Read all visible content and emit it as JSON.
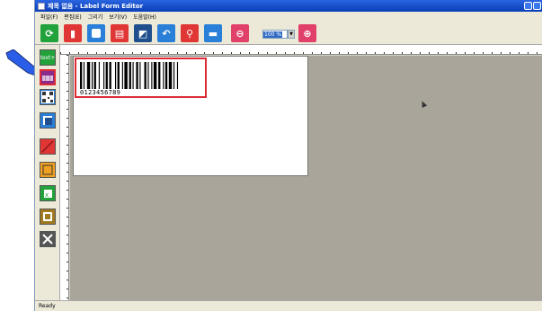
{
  "window": {
    "title": "제목 없음 - Label Form Editor"
  },
  "menu": {
    "items": [
      "파일(F)",
      "편집(E)",
      "그리기",
      "보기(V)",
      "도움말(H)"
    ]
  },
  "toolbar": {
    "buttons": [
      {
        "name": "new-button",
        "icon": "refresh-icon",
        "color": "#22a23a"
      },
      {
        "name": "open-button",
        "icon": "open-icon",
        "color": "#e03636"
      },
      {
        "name": "save-button",
        "icon": "save-icon",
        "color": "#2a7fd8"
      },
      {
        "name": "print-button",
        "icon": "printer-icon",
        "color": "#e03636"
      },
      {
        "name": "export-button",
        "icon": "export-icon",
        "color": "#1f4f8c"
      },
      {
        "name": "undo-button",
        "icon": "undo-icon",
        "color": "#2a7fd8"
      },
      {
        "name": "location-button",
        "icon": "pin-icon",
        "color": "#e03636"
      },
      {
        "name": "device-button",
        "icon": "device-icon",
        "color": "#2a7fd8"
      },
      {
        "name": "zoom-out-button",
        "icon": "zoom-out-icon",
        "color": "#e0406a"
      },
      {
        "name": "zoom-in-button",
        "icon": "zoom-in-icon",
        "color": "#e0406a"
      }
    ],
    "zoom_value": "100 %"
  },
  "palette": {
    "text_tool_label": "text+",
    "tools": [
      {
        "name": "text-tool",
        "icon": "text-icon",
        "color": "#22a23a"
      },
      {
        "name": "barcode-tool",
        "icon": "barcode-icon",
        "color": "#8a2a8a"
      },
      {
        "name": "qrcode-tool",
        "icon": "qrcode-icon",
        "color": "#2a7fd8"
      },
      {
        "name": "image-tool",
        "icon": "image-icon",
        "color": "#2a7fd8"
      },
      {
        "name": "line-tool",
        "icon": "line-icon",
        "color": "#e03636"
      },
      {
        "name": "rectangle-tool",
        "icon": "rectangle-icon",
        "color": "#f0a020"
      },
      {
        "name": "excel-tool",
        "icon": "excel-icon",
        "color": "#22a23a"
      },
      {
        "name": "database-tool",
        "icon": "database-icon",
        "color": "#a07a20"
      },
      {
        "name": "settings-tool",
        "icon": "wrench-icon",
        "color": "#555555"
      }
    ]
  },
  "canvas": {
    "barcode_value": "0123456789"
  },
  "status": {
    "text": "Ready"
  }
}
